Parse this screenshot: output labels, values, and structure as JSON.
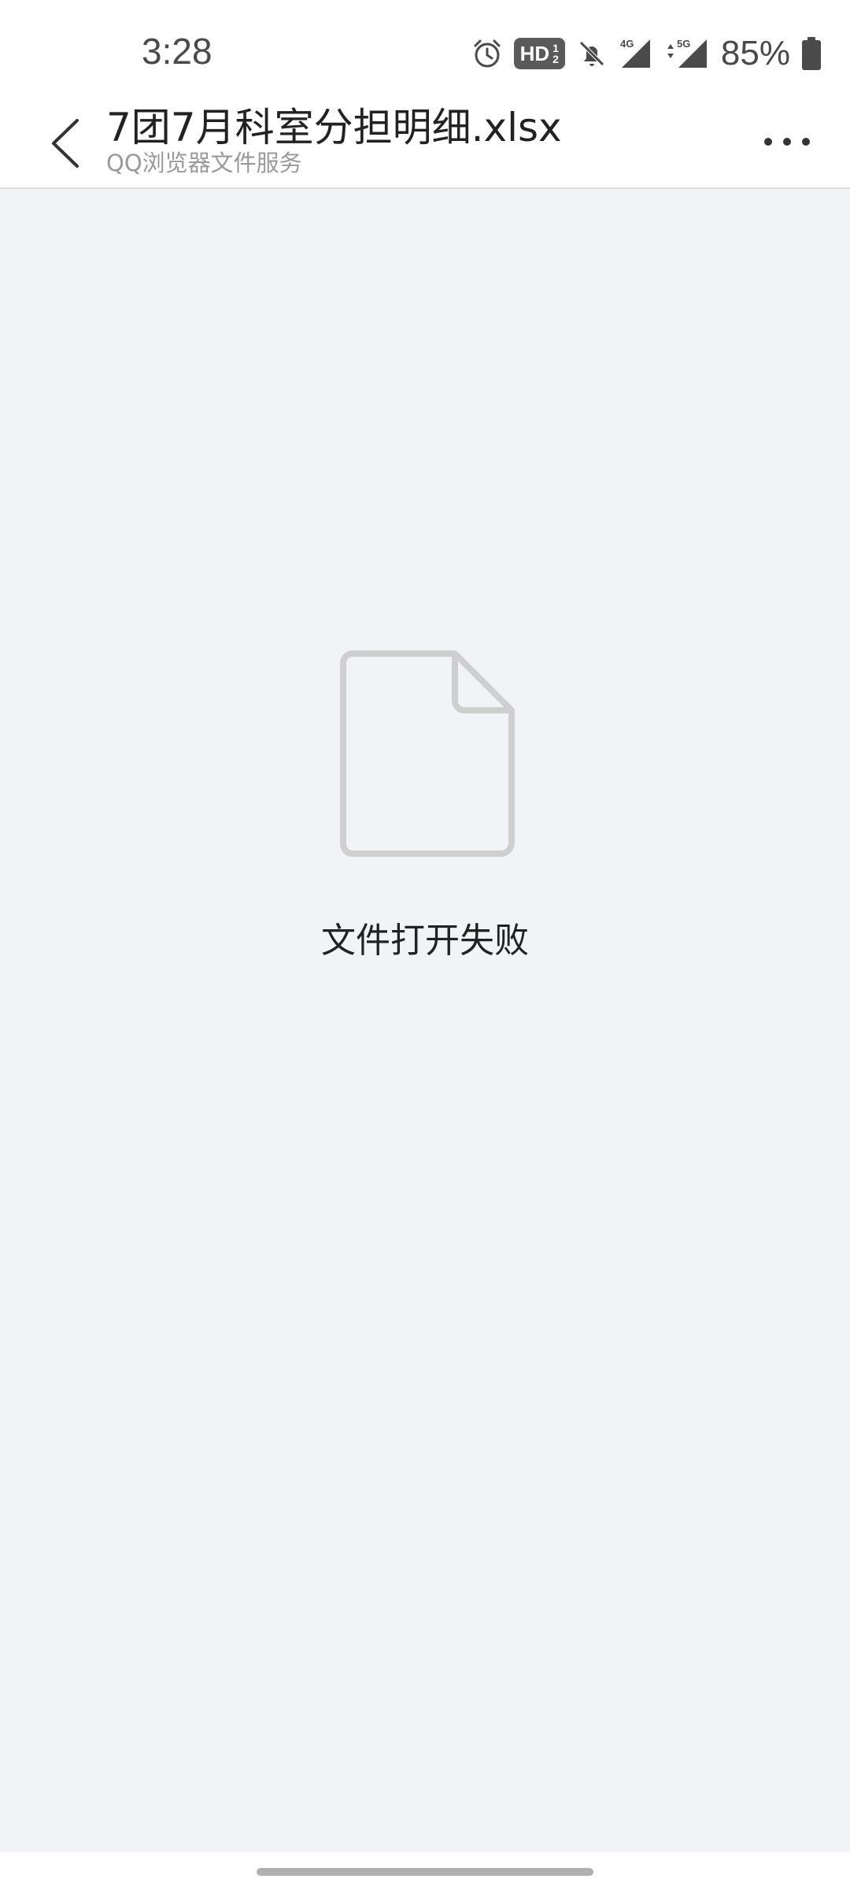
{
  "status_bar": {
    "time": "3:28",
    "hd_label": "HD",
    "hd_num": "1",
    "hd_den": "2",
    "net1": "4G",
    "net2": "5G",
    "battery": "85%"
  },
  "header": {
    "title": "7团7月科室分担明细.xlsx",
    "subtitle": "QQ浏览器文件服务"
  },
  "content": {
    "error_message": "文件打开失败"
  },
  "icons": {
    "back": "chevron-left-icon",
    "more": "more-horizontal-icon",
    "file": "document-icon"
  },
  "colors": {
    "background": "#f2f3f7",
    "header_bg": "#ffffff",
    "icon_gray": "#cfcfcf"
  }
}
